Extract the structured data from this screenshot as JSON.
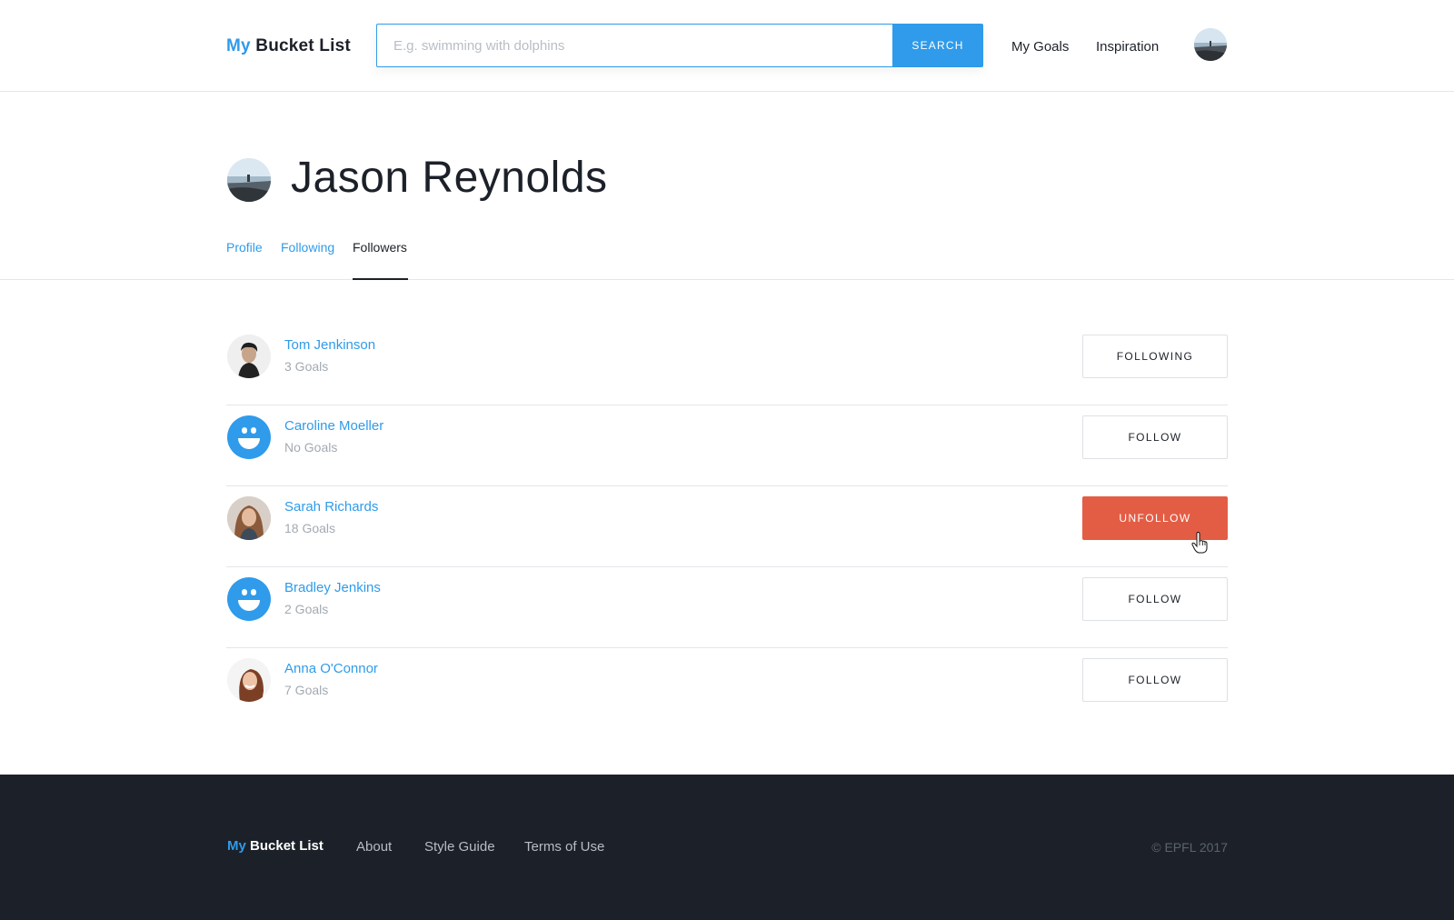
{
  "header": {
    "logo_my": "My",
    "logo_rest": " Bucket List",
    "search_placeholder": "E.g. swimming with dolphins",
    "search_button": "SEARCH",
    "nav": [
      "My Goals",
      "Inspiration"
    ],
    "avatar_icon": "user-avatar-icon"
  },
  "profile": {
    "name": "Jason Reynolds",
    "avatar_icon": "profile-avatar-icon"
  },
  "tabs": {
    "profile": "Profile",
    "following": "Following",
    "followers": "Followers",
    "active": "Followers"
  },
  "followers": [
    {
      "name": "Tom Jenkinson",
      "goals": "3 Goals",
      "button": "FOLLOWING",
      "avatar": "photo"
    },
    {
      "name": "Caroline Moeller",
      "goals": "No Goals",
      "button": "FOLLOW",
      "avatar": "smiley-icon"
    },
    {
      "name": "Sarah Richards",
      "goals": "18 Goals",
      "button": "UNFOLLOW",
      "avatar": "photo"
    },
    {
      "name": "Bradley Jenkins",
      "goals": "2 Goals",
      "button": "FOLLOW",
      "avatar": "smiley-icon"
    },
    {
      "name": "Anna O'Connor",
      "goals": "7 Goals",
      "button": "FOLLOW",
      "avatar": "photo"
    }
  ],
  "footer": {
    "logo_my": "My",
    "logo_rest": " Bucket List",
    "links": [
      "About",
      "Style Guide",
      "Terms of Use"
    ],
    "copyright": "© EPFL 2017"
  },
  "colors": {
    "accent": "#2f9bea",
    "danger": "#e35d45",
    "dark": "#1c2129",
    "muted": "#a3aab2"
  }
}
